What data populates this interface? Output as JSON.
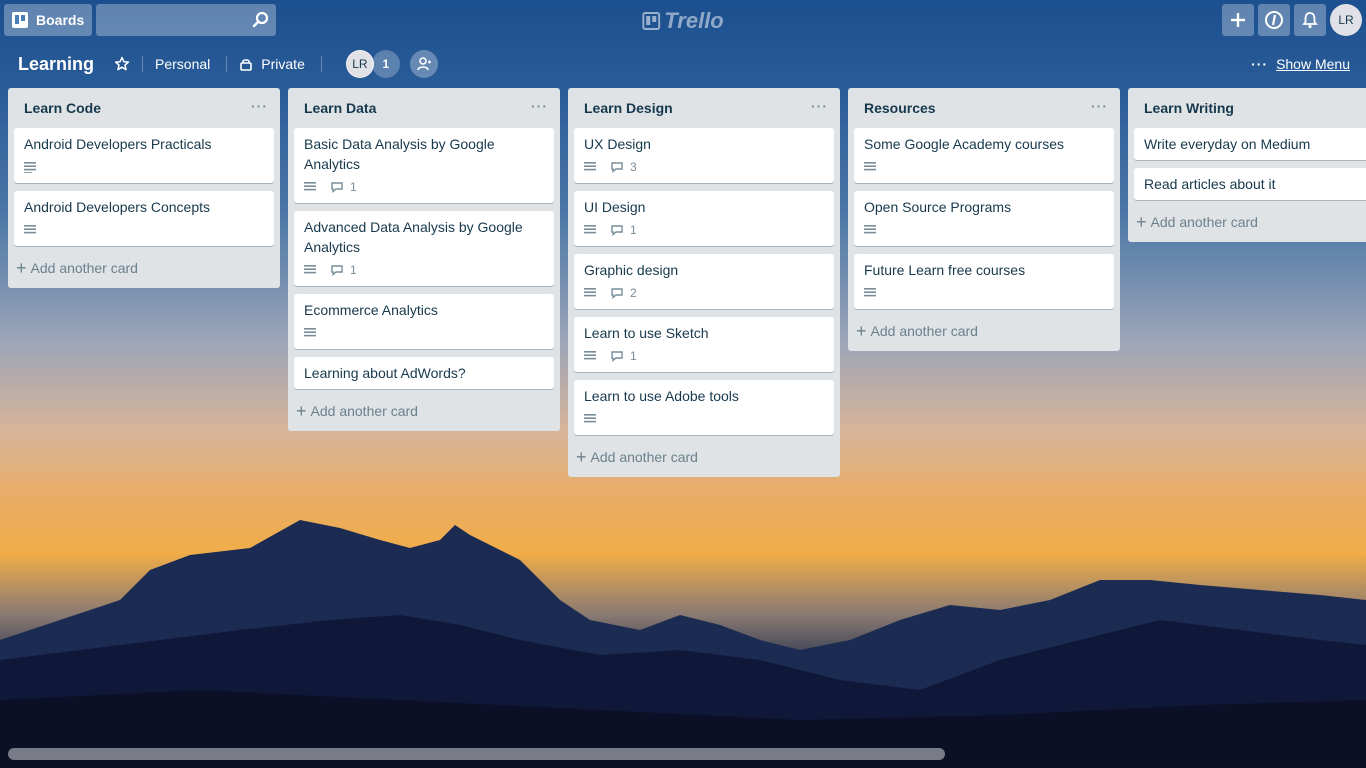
{
  "topbar": {
    "boards_label": "Boards",
    "search_placeholder": "",
    "logo_text": "Trello",
    "avatar_initials": "LR"
  },
  "board": {
    "title": "Learning",
    "team": "Personal",
    "visibility": "Private",
    "member_initials": "LR",
    "member_count": "1",
    "show_menu_label": "Show Menu"
  },
  "lists": [
    {
      "title": "Learn Code",
      "cards": [
        {
          "title": "Android Developers Practicals",
          "desc": true,
          "comments": ""
        },
        {
          "title": "Android Developers Concepts",
          "desc": true,
          "comments": ""
        }
      ],
      "add_label": "Add another card"
    },
    {
      "title": "Learn Data",
      "cards": [
        {
          "title": "Basic Data Analysis by Google Analytics",
          "desc": true,
          "comments": "1"
        },
        {
          "title": "Advanced Data Analysis by Google Analytics",
          "desc": true,
          "comments": "1"
        },
        {
          "title": "Ecommerce Analytics",
          "desc": true,
          "comments": ""
        },
        {
          "title": "Learning about AdWords?",
          "desc": false,
          "comments": ""
        }
      ],
      "add_label": "Add another card"
    },
    {
      "title": "Learn Design",
      "cards": [
        {
          "title": "UX Design",
          "desc": true,
          "comments": "3"
        },
        {
          "title": "UI Design",
          "desc": true,
          "comments": "1"
        },
        {
          "title": "Graphic design",
          "desc": true,
          "comments": "2"
        },
        {
          "title": "Learn to use Sketch",
          "desc": true,
          "comments": "1"
        },
        {
          "title": "Learn to use Adobe tools",
          "desc": true,
          "comments": ""
        }
      ],
      "add_label": "Add another card"
    },
    {
      "title": "Resources",
      "cards": [
        {
          "title": "Some Google Academy courses",
          "desc": true,
          "comments": ""
        },
        {
          "title": "Open Source Programs",
          "desc": true,
          "comments": ""
        },
        {
          "title": "Future Learn free courses",
          "desc": true,
          "comments": ""
        }
      ],
      "add_label": "Add another card"
    },
    {
      "title": "Learn Writing",
      "cards": [
        {
          "title": "Write everyday on Medium",
          "desc": false,
          "comments": ""
        },
        {
          "title": "Read articles about it",
          "desc": false,
          "comments": ""
        }
      ],
      "add_label": "Add another card"
    }
  ]
}
